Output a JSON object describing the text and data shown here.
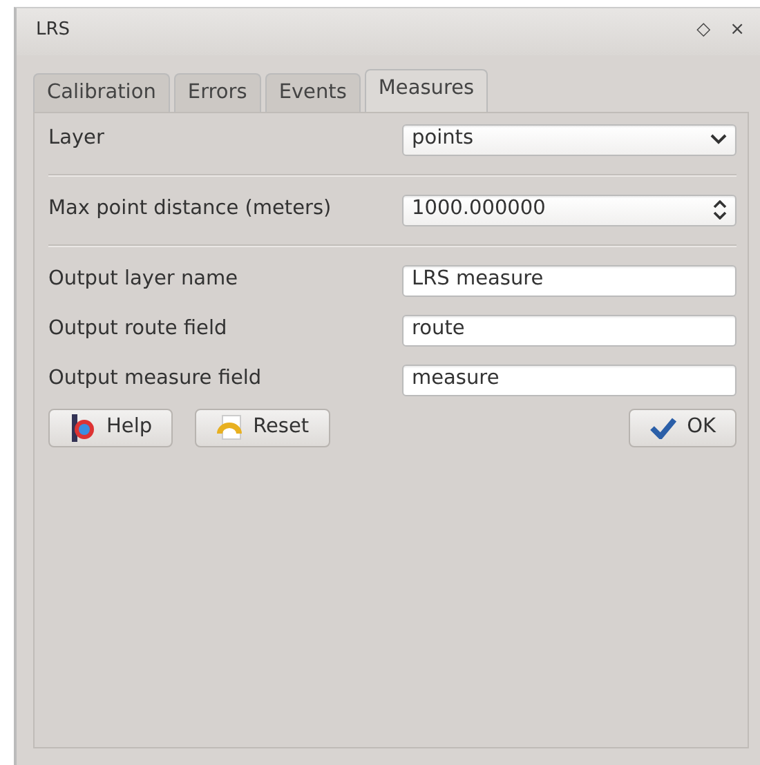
{
  "window": {
    "title": "LRS",
    "controls": [
      "◇",
      "×"
    ]
  },
  "tabs": [
    {
      "label": "Calibration",
      "selected": false
    },
    {
      "label": "Errors",
      "selected": false
    },
    {
      "label": "Events",
      "selected": false
    },
    {
      "label": "Measures",
      "selected": true
    }
  ],
  "form": {
    "layer": {
      "label": "Layer",
      "value": "points"
    },
    "max_distance": {
      "label": "Max point distance (meters)",
      "value": "1000.000000"
    },
    "fields": [
      {
        "label": "Output layer name",
        "value": "LRS measure"
      },
      {
        "label": "Output route field",
        "value": "route"
      },
      {
        "label": "Output measure field",
        "value": "measure"
      }
    ]
  },
  "buttons": [
    {
      "kind": "help",
      "label": "Help"
    },
    {
      "kind": "reset",
      "label": "Reset"
    },
    {
      "kind": "ok",
      "label": "OK"
    }
  ]
}
